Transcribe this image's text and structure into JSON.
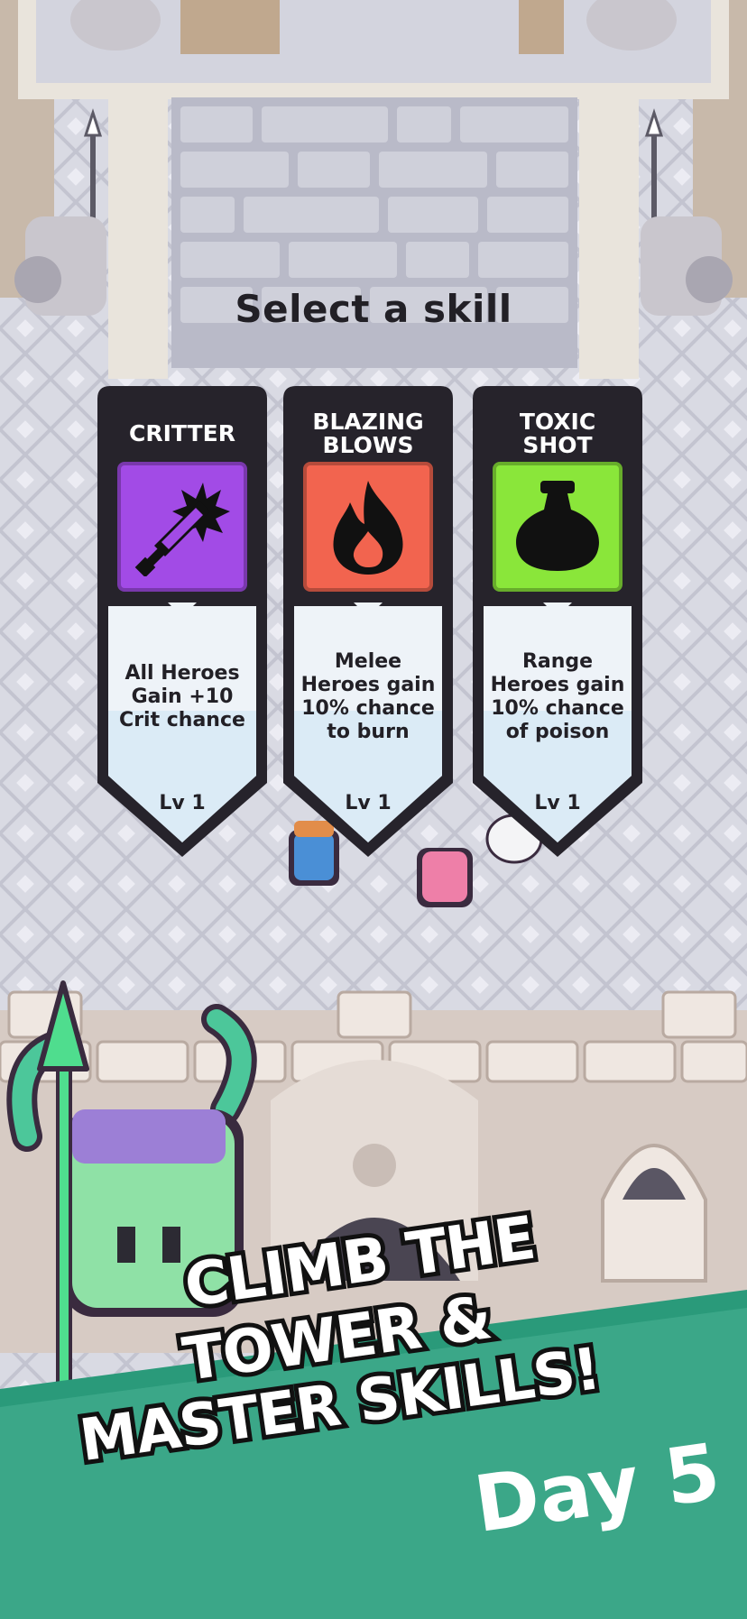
{
  "header": {
    "title": "Select a skill"
  },
  "cards": [
    {
      "title": "CRITTER",
      "icon": "sword-icon",
      "description": "All Heroes Gain +10 Crit chance",
      "level": "Lv 1",
      "color": "#a24be6"
    },
    {
      "title": "BLAZING BLOWS",
      "icon": "flame-icon",
      "description": "Melee Heroes gain 10% chance to burn",
      "level": "Lv 1",
      "color": "#f2644f"
    },
    {
      "title": "TOXIC SHOT",
      "icon": "potion-icon",
      "description": "Range Heroes gain 10% chance of poison",
      "level": "Lv 1",
      "color": "#8ae63a"
    }
  ],
  "promo": {
    "line1": "CLIMB THE",
    "line2": "TOWER &",
    "line3": "MASTER SKILLS!",
    "day": "Day 5"
  },
  "colors": {
    "card_frame": "#26232b",
    "banner": "#2a9a7a",
    "floor": "#dcdde6"
  }
}
